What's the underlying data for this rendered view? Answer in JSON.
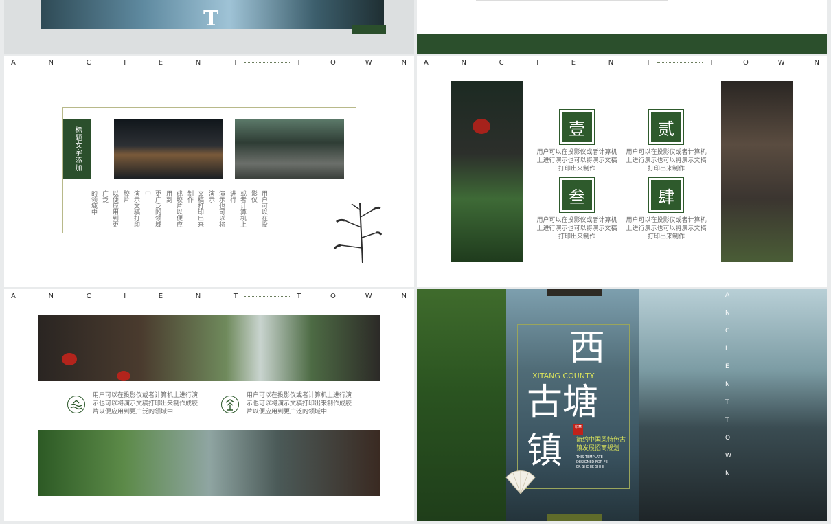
{
  "brand": {
    "green": "#2e5a2c",
    "dark_green": "#2b4f2c",
    "text_gray": "#6a6a6a"
  },
  "tracker": {
    "left": [
      "A",
      "N",
      "C",
      "I",
      "E",
      "N",
      "T"
    ],
    "right": [
      "T",
      "O",
      "W",
      "N"
    ]
  },
  "slide1": {
    "title_fragment": "T"
  },
  "slide3": {
    "vertical_title": "标题文字添加",
    "columns": [
      "用户可以在投影仪",
      "或者计算机上进行",
      "演示也可以将演示",
      "文稿打印出来制作",
      "成胶片以便应用到",
      "更广泛的领域中",
      "演示文稿打印胶片",
      "以便应用到更广泛",
      "的领域中"
    ],
    "icons": [
      "bamboo-icon"
    ]
  },
  "slide4": {
    "items": [
      {
        "numeral": "壹",
        "text": "用户可以在投影仪或者计算机上进行演示也可以将演示文稿打印出来制作"
      },
      {
        "numeral": "贰",
        "text": "用户可以在投影仪或者计算机上进行演示也可以将演示文稿打印出来制作"
      },
      {
        "numeral": "叁",
        "text": "用户可以在投影仪或者计算机上进行演示也可以将演示文稿打印出来制作"
      },
      {
        "numeral": "肆",
        "text": "用户可以在投影仪或者计算机上进行演示也可以将演示文稿打印出来制作"
      }
    ]
  },
  "slide5": {
    "items": [
      {
        "icon": "water-icon",
        "text": "用户可以在投影仪或者计算机上进行演示也可以将演示文稿打印出来制作成胶片以便应用到更广泛的领域中"
      },
      {
        "icon": "pagoda-icon",
        "text": "用户可以在投影仪或者计算机上进行演示也可以将演示文稿打印出来制作成胶片以便应用到更广泛的领域中"
      }
    ]
  },
  "slide6": {
    "title_xi": "西",
    "subtitle_en": "XITANG COUNTY",
    "title_gutang": "古塘",
    "title_zhen": "镇",
    "seal": "印章",
    "tagline": "简约中国风特色古镇发展招商规划",
    "small_en_1": "THIS TEMPLATE",
    "small_en_2": "DESIGNED FOR FEI",
    "small_en_3": "ER SHE JIE SHI JI",
    "vertical_en": [
      "A",
      "N",
      "C",
      "I",
      "E",
      "N",
      "T",
      "T",
      "O",
      "W",
      "N"
    ]
  }
}
